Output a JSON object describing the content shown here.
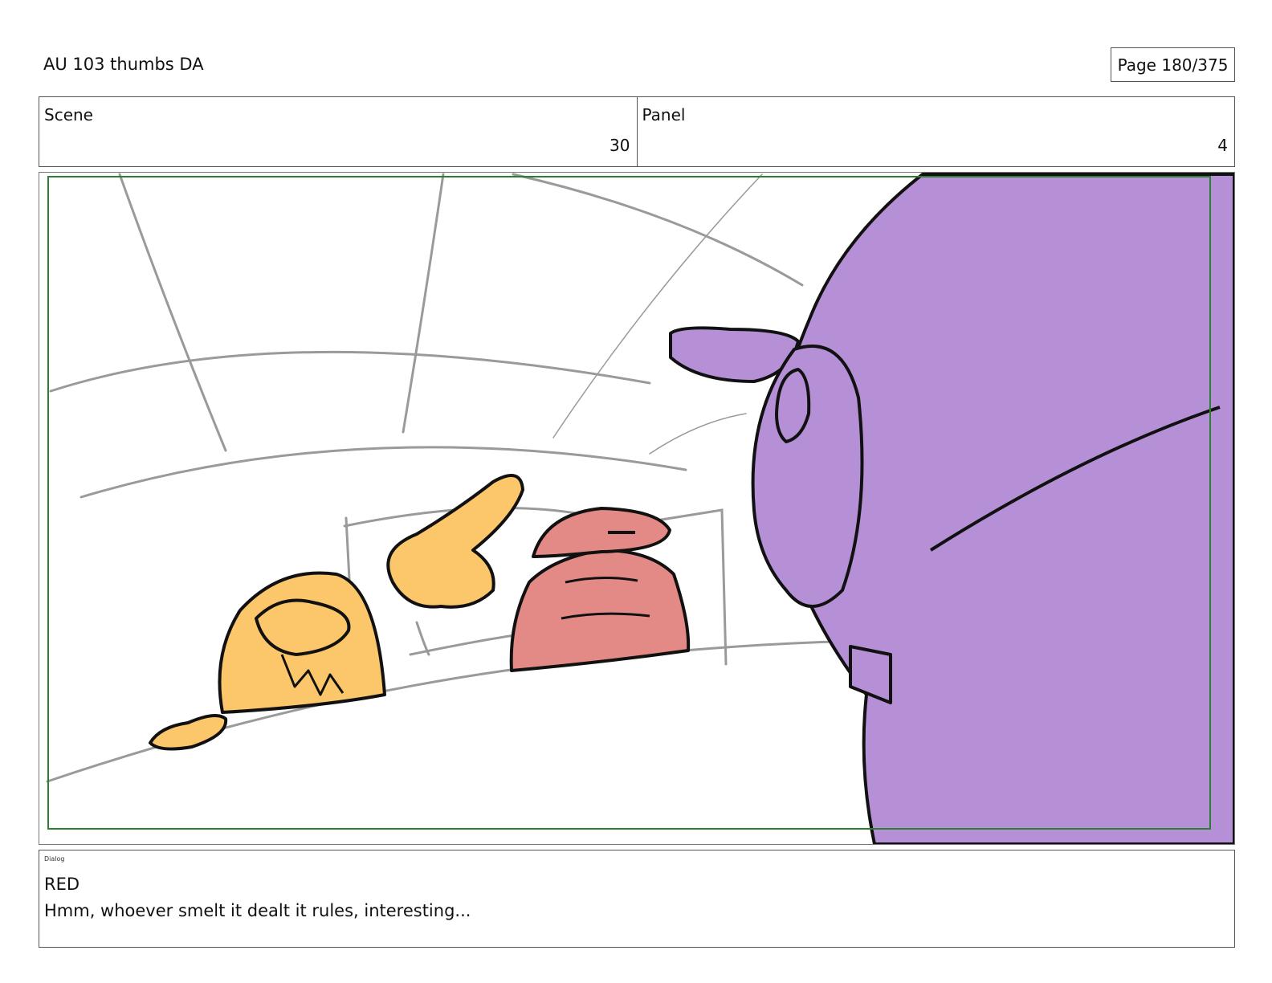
{
  "header": {
    "title": "AU 103 thumbs DA",
    "page": "Page 180/375"
  },
  "info": {
    "scene_label": "Scene",
    "scene_value": "30",
    "panel_label": "Panel",
    "panel_value": "4"
  },
  "dialog": {
    "tag": "Dialog",
    "speaker": "RED",
    "line": "Hmm, whoever smelt it dealt it rules, interesting..."
  },
  "colors": {
    "purple_character": "#b690d6",
    "orange_character": "#fcc66a",
    "red_character": "#e48a86",
    "frame_guide": "#2e7d32",
    "sketch_lines": "#9a9a9a"
  }
}
